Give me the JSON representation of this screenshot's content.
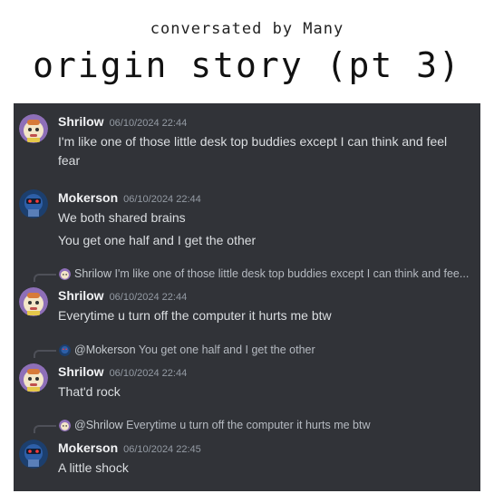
{
  "header": {
    "subtitle": "conversated by Many",
    "title": "origin story (pt 3)"
  },
  "messages": [
    {
      "author": "Shrilow",
      "timestamp": "06/10/2024 22:44",
      "lines": [
        "I'm like one of those little desk top buddies except I can think and feel",
        "fear"
      ]
    },
    {
      "author": "Mokerson",
      "timestamp": "06/10/2024 22:44",
      "lines": [
        "We both shared brains",
        "You get one half and I get the other"
      ]
    },
    {
      "reply": {
        "author": "Shrilow",
        "text": "I'm like one of those little desk top buddies except I can think and fee..."
      },
      "author": "Shrilow",
      "timestamp": "06/10/2024 22:44",
      "lines": [
        "Everytime u turn off the computer it hurts me btw"
      ]
    },
    {
      "reply": {
        "author": "@Mokerson",
        "text": "You get one half and I get the other"
      },
      "author": "Shrilow",
      "timestamp": "06/10/2024 22:44",
      "lines": [
        "That'd rock"
      ]
    },
    {
      "reply": {
        "author": "@Shrilow",
        "text": "Everytime u turn off the computer it hurts me btw"
      },
      "author": "Mokerson",
      "timestamp": "06/10/2024 22:45",
      "lines": [
        "A little shock"
      ]
    }
  ]
}
